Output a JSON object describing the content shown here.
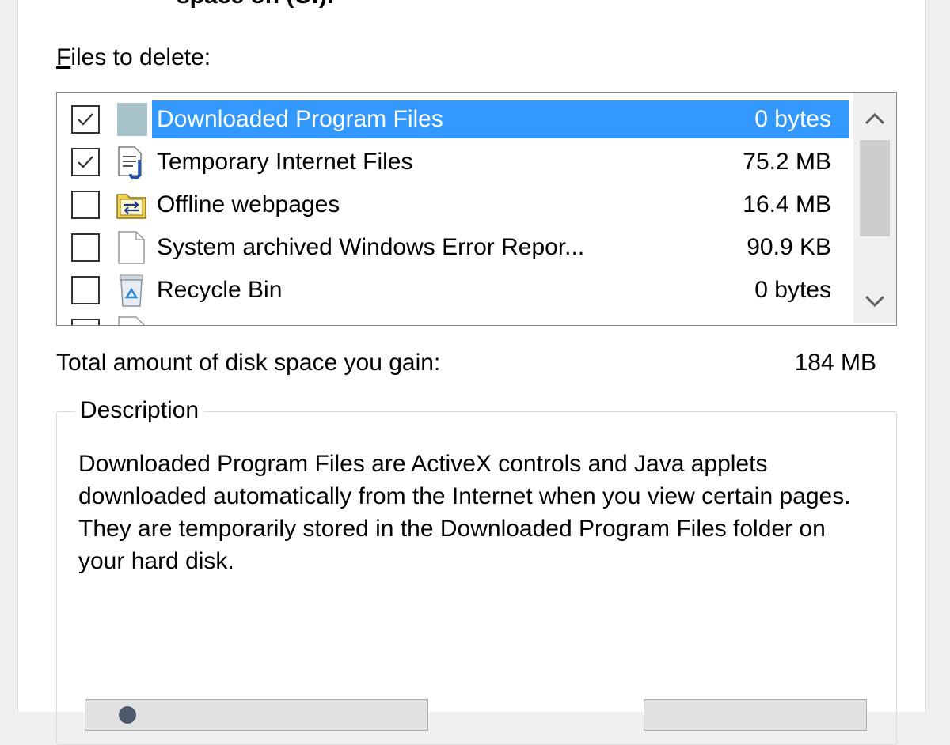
{
  "header": {
    "cut_text": "space on (C:)."
  },
  "files_to_delete": {
    "label_first": "F",
    "label_rest": "iles to delete:",
    "items": [
      {
        "name": "Downloaded Program Files",
        "size": "0 bytes",
        "checked": true,
        "selected": true,
        "icon": "folder-icon"
      },
      {
        "name": "Temporary Internet Files",
        "size": "75.2 MB",
        "checked": true,
        "selected": false,
        "icon": "document-icon"
      },
      {
        "name": "Offline webpages",
        "size": "16.4 MB",
        "checked": false,
        "selected": false,
        "icon": "offline-folder-icon"
      },
      {
        "name": "System archived Windows Error Repor...",
        "size": "90.9 KB",
        "checked": false,
        "selected": false,
        "icon": "blank-file-icon"
      },
      {
        "name": "Recycle Bin",
        "size": "0 bytes",
        "checked": false,
        "selected": false,
        "icon": "recycle-bin-icon"
      }
    ]
  },
  "total": {
    "label": "Total amount of disk space you gain:",
    "value": "184 MB"
  },
  "description": {
    "title": "Description",
    "text": "Downloaded Program Files are ActiveX controls and Java applets downloaded automatically from the Internet when you view certain pages. They are temporarily stored in the Downloaded Program Files folder on your hard disk."
  },
  "colors": {
    "selection": "#3399ff",
    "dialog_bg": "#ffffff",
    "scroll_thumb": "#cdcdcd"
  }
}
